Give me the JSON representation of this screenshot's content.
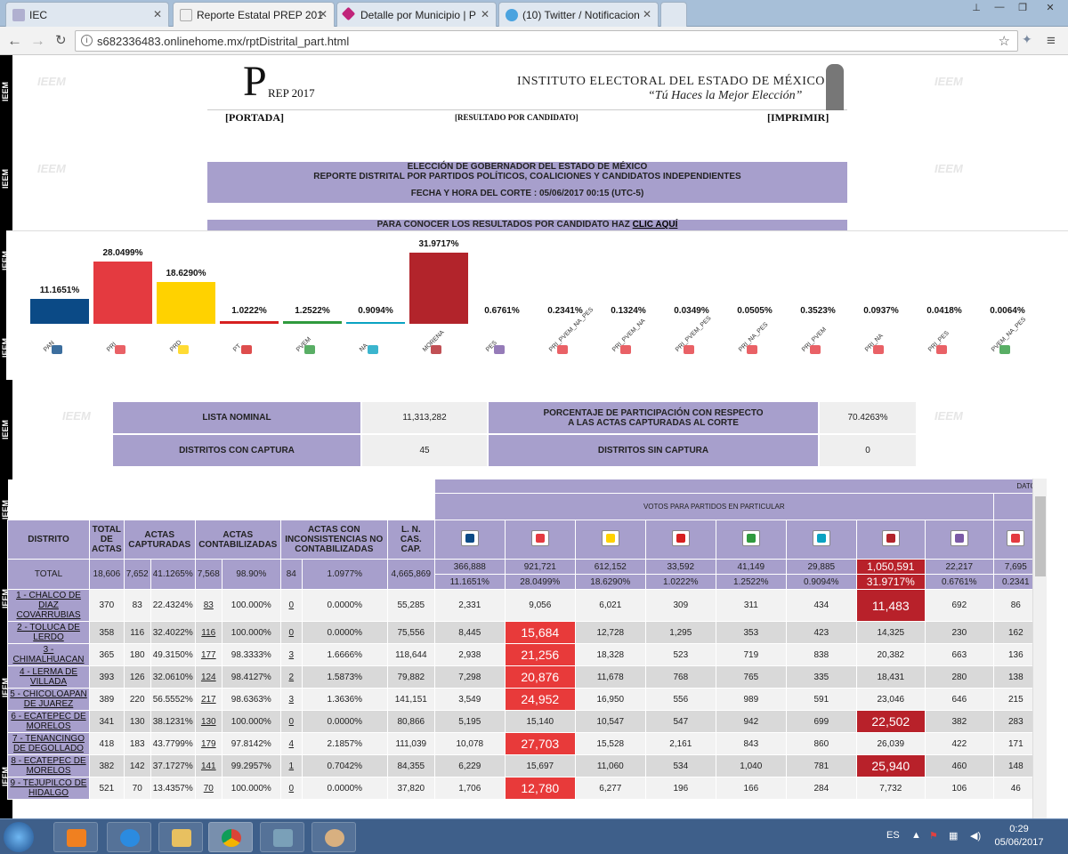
{
  "browser": {
    "tabs": [
      {
        "label": "IEC",
        "icon_color": "#b0b0d0"
      },
      {
        "label": "Reporte Estatal PREP 201",
        "icon_color": "#f0f0f0",
        "active": true
      },
      {
        "label": "Detalle por Municipio | P",
        "icon_color": "#c0247a"
      },
      {
        "label": "(10) Twitter / Notificacion",
        "icon_color": "#4aa3df"
      }
    ],
    "url": "s682336483.onlinehome.mx/rptDistrital_part.html",
    "back": "←",
    "forward": "→",
    "reload": "C",
    "star": "☆",
    "menu": "≡"
  },
  "header": {
    "logo_letter": "P",
    "logo_sub": "REP 2017",
    "institute": "INSTITUTO ELECTORAL DEL ESTADO DE MÉXICO",
    "slogan": "“Tú Haces la Mejor Elección”",
    "portada": "[PORTADA]",
    "resultado": "[RESULTADO POR CANDIDATO]",
    "imprimir": "[IMPRIMIR]"
  },
  "side_label": "IEEM",
  "watermark": "IEEM",
  "banner": {
    "line1": "ELECCIÓN DE GOBERNADOR DEL ESTADO DE MÉXICO",
    "line2": "REPORTE DISTRITAL POR PARTIDOS POLÍTICOS, COALICIONES Y CANDIDATOS INDEPENDIENTES",
    "line3": "FECHA Y HORA DEL CORTE : 05/06/2017 00:15 (UTC-5)",
    "cta_prefix": "PARA CONOCER LOS RESULTADOS POR CANDIDATO HAZ ",
    "cta_link": "CLIC AQUÍ"
  },
  "chart_data": {
    "type": "bar",
    "categories": [
      "PAN",
      "PRI",
      "PRD",
      "PT",
      "PVEM",
      "NA",
      "MORENA",
      "PES",
      "PRI_PVEM_NA_PES",
      "PRI_PVEM_NA",
      "PRI_PVEM_PES",
      "PRI_NA_PES",
      "PRI_PVEM",
      "PRI_NA",
      "PRI_PES",
      "PVEM_NA_PES"
    ],
    "values": [
      11.1651,
      28.0499,
      18.629,
      1.0222,
      1.2522,
      0.9094,
      31.9717,
      0.6761,
      0.2341,
      0.1324,
      0.0349,
      0.0505,
      0.3523,
      0.0937,
      0.0418,
      0.0064
    ],
    "labels": [
      "11.1651%",
      "28.0499%",
      "18.6290%",
      "1.0222%",
      "1.2522%",
      "0.9094%",
      "31.9717%",
      "0.6761%",
      "0.2341%",
      "0.1324%",
      "0.0349%",
      "0.0505%",
      "0.3523%",
      "0.0937%",
      "0.0418%",
      "0.0064%"
    ],
    "colors": [
      "#0b4a86",
      "#e43a40",
      "#ffd200",
      "#d62020",
      "#2f9a3e",
      "#0aa3c2",
      "#b2242b",
      "#7b5aa6",
      "#e43a40",
      "#e43a40",
      "#e43a40",
      "#e43a40",
      "#e43a40",
      "#e43a40",
      "#e43a40",
      "#2f9a3e"
    ],
    "ylim": [
      0,
      35
    ]
  },
  "summary": {
    "lista_label": "LISTA NOMINAL",
    "lista_value": "11,313,282",
    "participacion_label1": "PORCENTAJE DE PARTICIPACIÓN CON RESPECTO",
    "participacion_label2": "A LAS ACTAS CAPTURADAS AL CORTE",
    "participacion_value": "70.4263%",
    "con_captura_label": "DISTRITOS CON CAPTURA",
    "con_captura_value": "45",
    "sin_captura_label": "DISTRITOS SIN CAPTURA",
    "sin_captura_value": "0"
  },
  "table": {
    "datos_label": "DATO",
    "votos_label": "VOTOS PARA PARTIDOS EN PARTICULAR",
    "h_distrito": "DISTRITO",
    "h_total_actas": "TOTAL DE ACTAS",
    "h_capturadas": "ACTAS CAPTURADAS",
    "h_contabilizadas": "ACTAS CONTABILIZADAS",
    "h_inconsistencias": "ACTAS CON INCONSISTENCIAS NO CONTABILIZADAS",
    "h_lncas": "L. N. CAS. CAP.",
    "total_label": "TOTAL",
    "total": {
      "actas": "18,606",
      "capt": "7,652",
      "capt_pct": "41.1265%",
      "cont": "7,568",
      "cont_pct": "98.90%",
      "inc": "84",
      "inc_pct": "1.0977%",
      "ln": "4,665,869",
      "votes": [
        "366,888",
        "921,721",
        "612,152",
        "33,592",
        "41,149",
        "29,885",
        "1,050,591",
        "22,217",
        "7,695"
      ],
      "pcts": [
        "11.1651%",
        "28.0499%",
        "18.6290%",
        "1.0222%",
        "1.2522%",
        "0.9094%",
        "31.9717%",
        "0.6761%",
        "0.2341"
      ]
    },
    "rows": [
      {
        "dist": "1 - CHALCO DE DIAZ COVARRUBIAS",
        "actas": "370",
        "capt": "83",
        "capt_pct": "22.4324%",
        "cont": "83",
        "cont_pct": "100.000%",
        "inc": "0",
        "inc_pct": "0.0000%",
        "ln": "55,285",
        "votes": [
          "2,331",
          "9,056",
          "6,021",
          "309",
          "311",
          "434",
          "11,483",
          "692",
          "86"
        ],
        "win": 6
      },
      {
        "dist": "2 - TOLUCA DE LERDO",
        "actas": "358",
        "capt": "116",
        "capt_pct": "32.4022%",
        "cont": "116",
        "cont_pct": "100.000%",
        "inc": "0",
        "inc_pct": "0.0000%",
        "ln": "75,556",
        "votes": [
          "8,445",
          "15,684",
          "12,728",
          "1,295",
          "353",
          "423",
          "14,325",
          "230",
          "162"
        ],
        "win": 1
      },
      {
        "dist": "3 - CHIMALHUACAN",
        "actas": "365",
        "capt": "180",
        "capt_pct": "49.3150%",
        "cont": "177",
        "cont_pct": "98.3333%",
        "inc": "3",
        "inc_pct": "1.6666%",
        "ln": "118,644",
        "votes": [
          "2,938",
          "21,256",
          "18,328",
          "523",
          "719",
          "838",
          "20,382",
          "663",
          "136"
        ],
        "win": 1
      },
      {
        "dist": "4 - LERMA DE VILLADA",
        "actas": "393",
        "capt": "126",
        "capt_pct": "32.0610%",
        "cont": "124",
        "cont_pct": "98.4127%",
        "inc": "2",
        "inc_pct": "1.5873%",
        "ln": "79,882",
        "votes": [
          "7,298",
          "20,876",
          "11,678",
          "768",
          "765",
          "335",
          "18,431",
          "280",
          "138"
        ],
        "win": 1
      },
      {
        "dist": "5 - CHICOLOAPAN DE JUAREZ",
        "actas": "389",
        "capt": "220",
        "capt_pct": "56.5552%",
        "cont": "217",
        "cont_pct": "98.6363%",
        "inc": "3",
        "inc_pct": "1.3636%",
        "ln": "141,151",
        "votes": [
          "3,549",
          "24,952",
          "16,950",
          "556",
          "989",
          "591",
          "23,046",
          "646",
          "215"
        ],
        "win": 1
      },
      {
        "dist": "6 - ECATEPEC DE MORELOS",
        "actas": "341",
        "capt": "130",
        "capt_pct": "38.1231%",
        "cont": "130",
        "cont_pct": "100.000%",
        "inc": "0",
        "inc_pct": "0.0000%",
        "ln": "80,866",
        "votes": [
          "5,195",
          "15,140",
          "10,547",
          "547",
          "942",
          "699",
          "22,502",
          "382",
          "283"
        ],
        "win": 6
      },
      {
        "dist": "7 - TENANCINGO DE DEGOLLADO",
        "actas": "418",
        "capt": "183",
        "capt_pct": "43.7799%",
        "cont": "179",
        "cont_pct": "97.8142%",
        "inc": "4",
        "inc_pct": "2.1857%",
        "ln": "111,039",
        "votes": [
          "10,078",
          "27,703",
          "15,528",
          "2,161",
          "843",
          "860",
          "26,039",
          "422",
          "171"
        ],
        "win": 1
      },
      {
        "dist": "8 - ECATEPEC DE MORELOS",
        "actas": "382",
        "capt": "142",
        "capt_pct": "37.1727%",
        "cont": "141",
        "cont_pct": "99.2957%",
        "inc": "1",
        "inc_pct": "0.7042%",
        "ln": "84,355",
        "votes": [
          "6,229",
          "15,697",
          "11,060",
          "534",
          "1,040",
          "781",
          "25,940",
          "460",
          "148"
        ],
        "win": 6
      },
      {
        "dist": "9 - TEJUPILCO DE HIDALGO",
        "actas": "521",
        "capt": "70",
        "capt_pct": "13.4357%",
        "cont": "70",
        "cont_pct": "100.000%",
        "inc": "0",
        "inc_pct": "0.0000%",
        "ln": "37,820",
        "votes": [
          "1,706",
          "12,780",
          "6,277",
          "196",
          "166",
          "284",
          "7,732",
          "106",
          "46"
        ],
        "win": 1
      }
    ],
    "party_logos": [
      "pan-logo",
      "pri-logo",
      "prd-logo",
      "pt-logo",
      "pvem-logo",
      "na-logo",
      "morena-logo",
      "pes-logo",
      "coalicion-logo"
    ],
    "party_colors": [
      "#0b4a86",
      "#e43a40",
      "#ffd200",
      "#d62020",
      "#2f9a3e",
      "#0aa3c2",
      "#b2242b",
      "#7b5aa6",
      "#e43a40"
    ]
  },
  "taskbar": {
    "lang": "ES",
    "time": "0:29",
    "date": "05/06/2017"
  }
}
